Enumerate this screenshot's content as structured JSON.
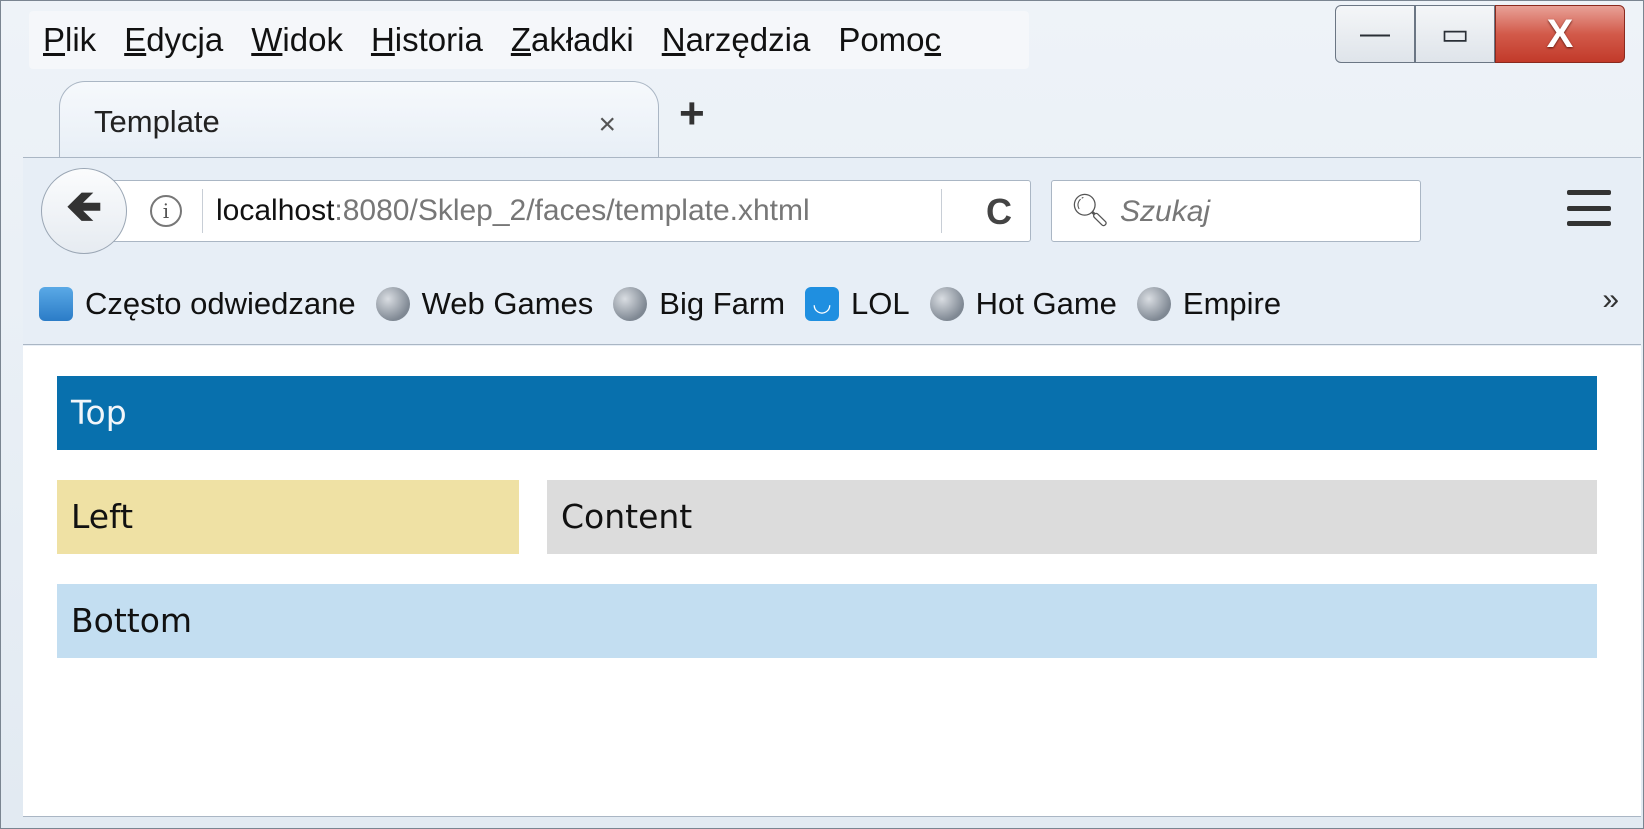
{
  "menubar": {
    "items": [
      {
        "u": "P",
        "rest": "lik"
      },
      {
        "u": "E",
        "rest": "dycja"
      },
      {
        "u": "W",
        "rest": "idok"
      },
      {
        "u": "H",
        "rest": "istoria"
      },
      {
        "u": "Z",
        "rest": "akładki"
      },
      {
        "u": "N",
        "rest": "arzędzia"
      },
      {
        "pre": "Pomo",
        "u": "c"
      }
    ]
  },
  "window_controls": {
    "minimize": "—",
    "maximize": "▭",
    "close": "X"
  },
  "tab": {
    "title": "Template",
    "close": "×",
    "new_tab": "+"
  },
  "nav": {
    "back": "🡸",
    "url_host": "localhost",
    "url_rest": ":8080/Sklep_2/faces/template.xhtml",
    "reload": "C",
    "search_placeholder": "Szukaj"
  },
  "bookmarks": {
    "items": [
      {
        "label": "Często odwiedzane",
        "icon": "frequent-icon"
      },
      {
        "label": "Web Games",
        "icon": "globe-icon"
      },
      {
        "label": "Big Farm",
        "icon": "globe-icon"
      },
      {
        "label": "LOL",
        "icon": "lol-icon"
      },
      {
        "label": "Hot Game",
        "icon": "globe-icon"
      },
      {
        "label": "Empire",
        "icon": "globe-icon"
      }
    ],
    "more": "»"
  },
  "page": {
    "top": "Top",
    "left": "Left",
    "content": "Content",
    "bottom": "Bottom"
  },
  "colors": {
    "top": "#0870ad",
    "left": "#efe1a4",
    "content": "#dcdcdc",
    "bottom": "#c3def1",
    "close_button": "#d25a4a"
  }
}
